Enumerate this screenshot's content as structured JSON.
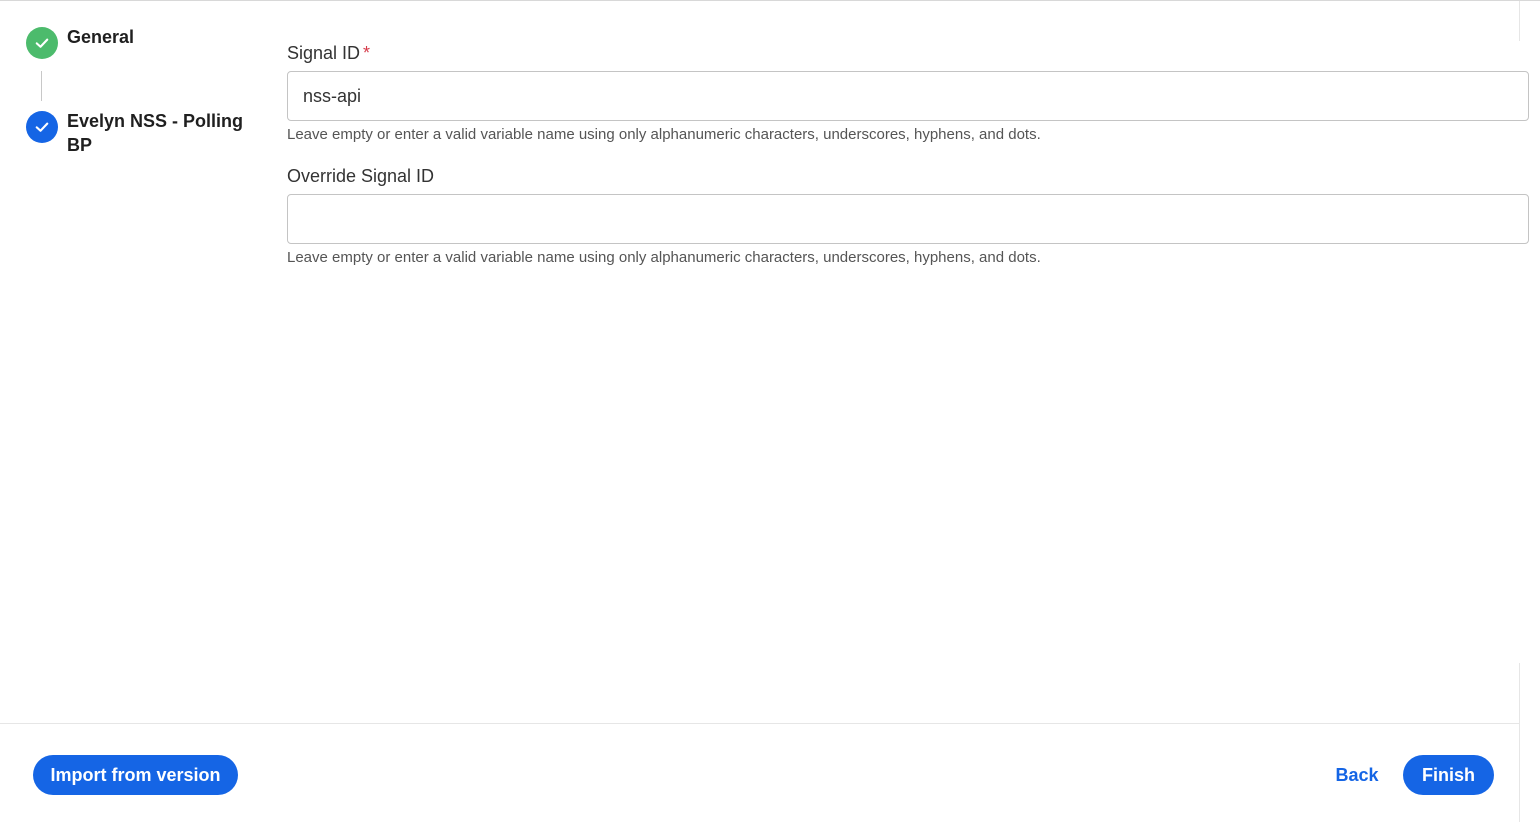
{
  "stepper": {
    "steps": [
      {
        "label": "General",
        "status": "complete",
        "color": "#4cbb6c"
      },
      {
        "label": "Evelyn NSS - Polling BP",
        "status": "active",
        "color": "#1565e5"
      }
    ]
  },
  "form": {
    "signal_id": {
      "label": "Signal ID",
      "required_mark": "*",
      "value": "nss-api",
      "helper": "Leave empty or enter a valid variable name using only alphanumeric characters, underscores, hyphens, and dots."
    },
    "override_signal_id": {
      "label": "Override Signal ID",
      "value": "",
      "helper": "Leave empty or enter a valid variable name using only alphanumeric characters, underscores, hyphens, and dots."
    }
  },
  "footer": {
    "import_label": "Import from version",
    "back_label": "Back",
    "finish_label": "Finish"
  },
  "colors": {
    "primary": "#1565e5",
    "success": "#4cbb6c",
    "required": "#d63a4a"
  }
}
